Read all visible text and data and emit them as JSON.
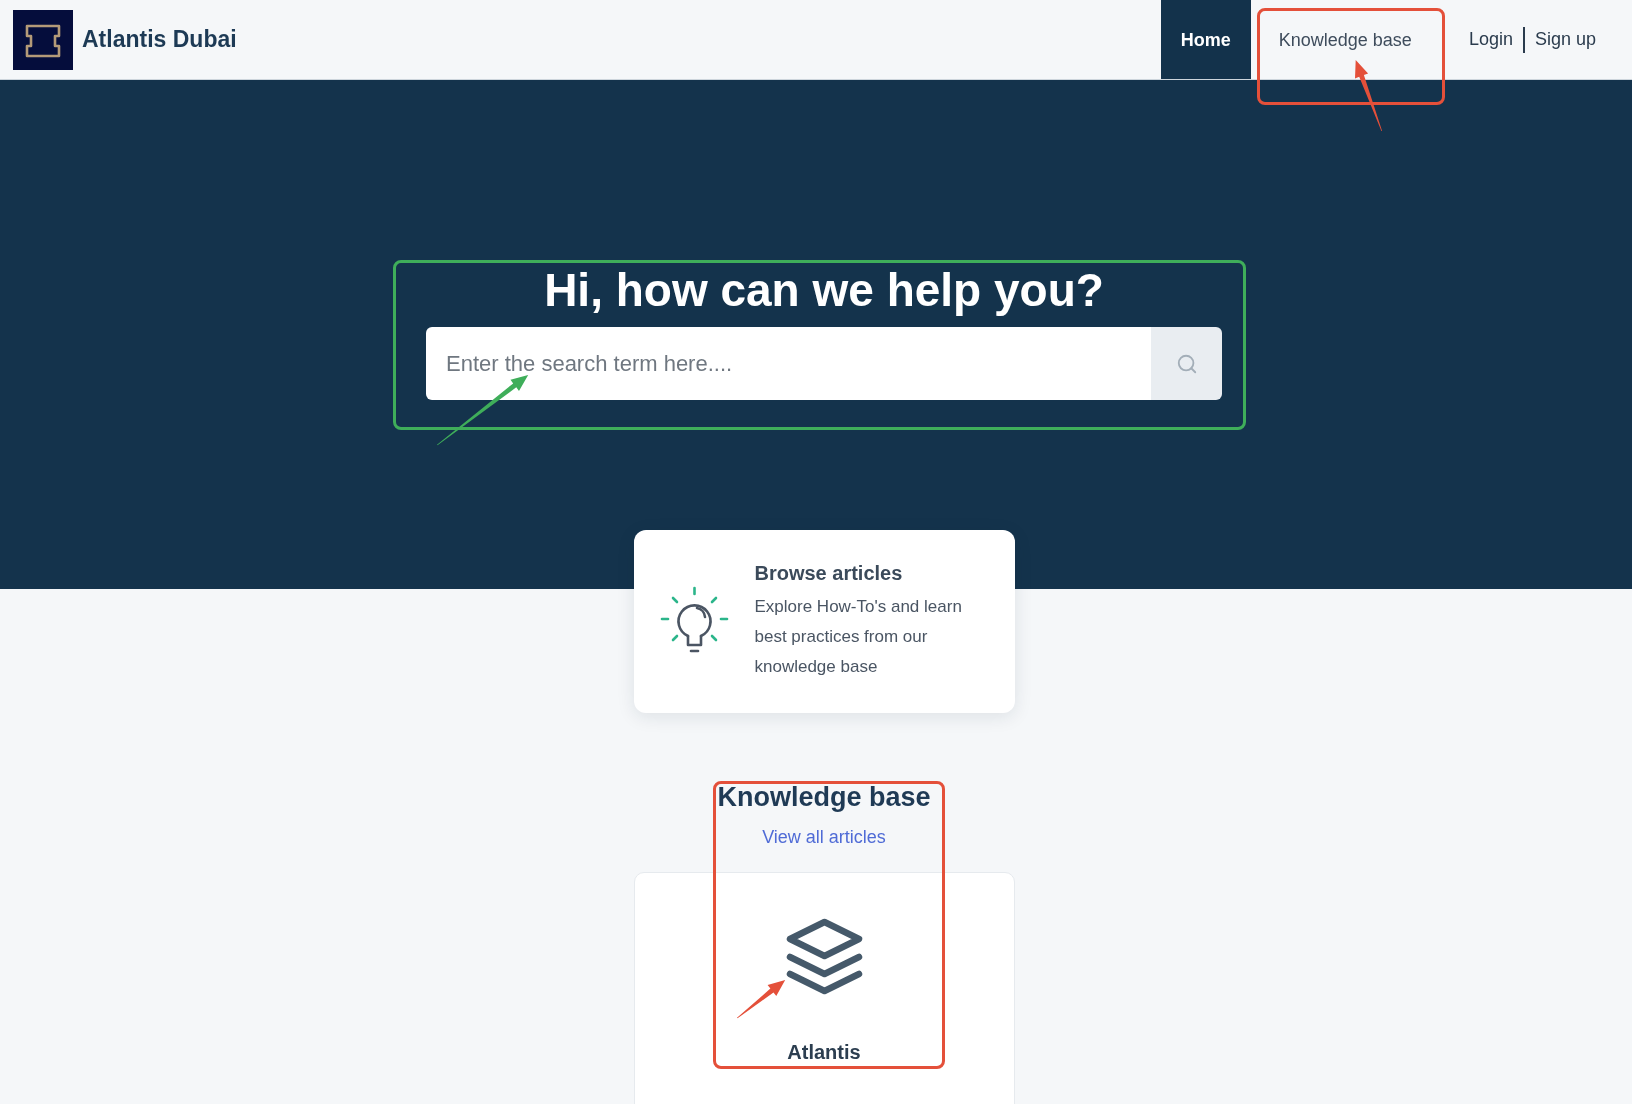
{
  "header": {
    "brand": "Atlantis Dubai",
    "nav": [
      {
        "label": "Home",
        "selected": true
      },
      {
        "label": "Knowledge base",
        "selected": false
      }
    ],
    "auth_links": [
      "Login",
      "Sign up"
    ]
  },
  "hero": {
    "title": "Hi, how can we help you?",
    "search": {
      "placeholder": "Enter the search term here...."
    }
  },
  "feature_card": {
    "title": "Browse articles",
    "description": "Explore How-To's and learn best practices from our knowledge base"
  },
  "knowledge_base": {
    "title": "Knowledge base",
    "link": "View all articles",
    "categories": [
      {
        "name": "Atlantis"
      }
    ]
  },
  "annotations": [
    {
      "kind": "box",
      "color": "#e4503a"
    },
    {
      "kind": "arrow",
      "color": "#e4503a"
    },
    {
      "kind": "box",
      "color": "#3fae5a"
    },
    {
      "kind": "arrow",
      "color": "#3fae5a"
    },
    {
      "kind": "box",
      "color": "#e4503a"
    },
    {
      "kind": "arrow",
      "color": "#e4503a"
    }
  ]
}
